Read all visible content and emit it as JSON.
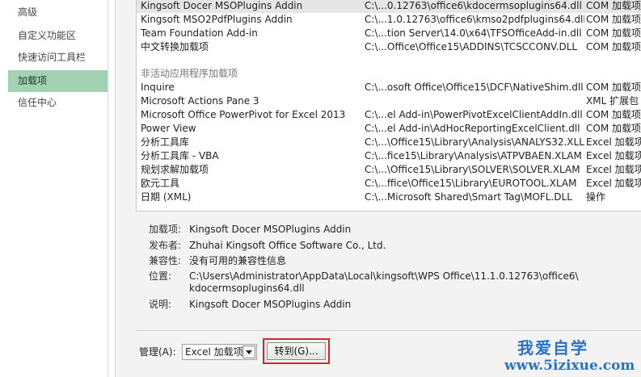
{
  "nav": {
    "items": [
      "高级",
      "自定义功能区",
      "快速访问工具栏",
      "加载项",
      "信任中心"
    ],
    "selected_index": 3
  },
  "list": {
    "active_rows": [
      {
        "name": "Kingsoft Docer MSOPlugins Addin",
        "location": "C:\\...0.12763\\office6\\kdocermsoplugins64.dll",
        "type": "COM 加载项",
        "selected": true
      },
      {
        "name": "Kingsoft MSO2PdfPlugins Addin",
        "location": "C:\\...1.0.12763\\office6\\kmso2pdfplugins64.dll",
        "type": "COM 加载项"
      },
      {
        "name": "Team Foundation Add-in",
        "location": "C:\\...tion Server\\14.0\\x64\\TFSOfficeAdd-in.dll",
        "type": "COM 加载项"
      },
      {
        "name": "中文转换加载项",
        "location": "C:\\...Office\\Office15\\ADDINS\\TCSCCONV.DLL",
        "type": "COM 加载项"
      }
    ],
    "inactive_header": "非活动应用程序加载项",
    "inactive_rows": [
      {
        "name": "Inquire",
        "location": "C:\\...osoft Office\\Office15\\DCF\\NativeShim.dll",
        "type": "COM 加载项"
      },
      {
        "name": "Microsoft Actions Pane 3",
        "location": "",
        "type": "XML 扩展包"
      },
      {
        "name": "Microsoft Office PowerPivot for Excel 2013",
        "location": "C:\\...el Add-in\\PowerPivotExcelClientAddIn.dll",
        "type": "COM 加载项"
      },
      {
        "name": "Power View",
        "location": "C:\\...el Add-in\\AdHocReportingExcelClient.dll",
        "type": "COM 加载项"
      },
      {
        "name": "分析工具库",
        "location": "C:\\...\\Office15\\Library\\Analysis\\ANALYS32.XLL",
        "type": "Excel 加载项"
      },
      {
        "name": "分析工具库 - VBA",
        "location": "C:\\...fice15\\Library\\Analysis\\ATPVBAEN.XLAM",
        "type": "Excel 加载项"
      },
      {
        "name": "规划求解加载项",
        "location": "C:\\...\\Office15\\Library\\SOLVER\\SOLVER.XLAM",
        "type": "Excel 加载项"
      },
      {
        "name": "欧元工具",
        "location": "C:\\...ffice\\Office15\\Library\\EUROTOOL.XLAM",
        "type": "Excel 加载项"
      },
      {
        "name": "日期 (XML)",
        "location": "C:\\...Microsoft Shared\\Smart Tag\\MOFL.DLL",
        "type": "操作"
      }
    ]
  },
  "details": {
    "addin_label": "加载项:",
    "addin_value": "Kingsoft Docer MSOPlugins Addin",
    "publisher_label": "发布者:",
    "publisher_value": "Zhuhai Kingsoft Office Software Co., Ltd.",
    "compat_label": "兼容性:",
    "compat_value": "没有可用的兼容性信息",
    "location_label": "位置:",
    "location_line1": "C:\\Users\\Administrator\\AppData\\Local\\kingsoft\\WPS Office\\11.1.0.12763\\office6\\",
    "location_line2": "kdocermsoplugins64.dll",
    "desc_label": "说明:",
    "desc_value": "Kingsoft Docer MSOPlugins Addin"
  },
  "manage": {
    "label": "管理(A):",
    "selected": "Excel 加载项",
    "go_label": "转到(G)..."
  },
  "watermark": {
    "cn": "我爱自学",
    "url": "www.5izixue.com"
  },
  "colors": {
    "nav_selected": "#a3d2b2",
    "highlight_border": "#d3272c",
    "watermark": "#2a72c6"
  }
}
